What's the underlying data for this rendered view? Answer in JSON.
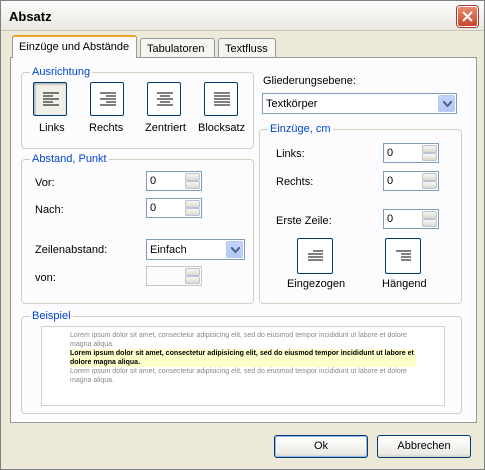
{
  "window": {
    "title": "Absatz"
  },
  "tabs": [
    {
      "label": "Einzüge und Abstände",
      "active": true
    },
    {
      "label": "Tabulatoren",
      "active": false
    },
    {
      "label": "Textfluss",
      "active": false
    }
  ],
  "alignment": {
    "group_label": "Ausrichtung",
    "buttons": [
      {
        "label": "Links",
        "icon": "align-left-icon",
        "pressed": true
      },
      {
        "label": "Rechts",
        "icon": "align-right-icon",
        "pressed": false
      },
      {
        "label": "Zentriert",
        "icon": "align-center-icon",
        "pressed": false
      },
      {
        "label": "Blocksatz",
        "icon": "align-justify-icon",
        "pressed": false
      }
    ]
  },
  "outline": {
    "label": "Gliederungsebene:",
    "value": "Textkörper"
  },
  "spacing": {
    "group_label": "Abstand, Punkt",
    "before_label": "Vor:",
    "before_value": "0",
    "after_label": "Nach:",
    "after_value": "0",
    "line_label": "Zeilenabstand:",
    "line_value": "Einfach",
    "of_label": "von:",
    "of_value": ""
  },
  "indent": {
    "group_label": "Einzüge, cm",
    "left_label": "Links:",
    "left_value": "0",
    "right_label": "Rechts:",
    "right_value": "0",
    "first_label": "Erste Zeile:",
    "first_value": "0",
    "indented_label": "Eingezogen",
    "hanging_label": "Hängend"
  },
  "example": {
    "group_label": "Beispiel",
    "line1": "Lorem ipsum dolor sit amet, consectetur adipisicing elit, sed do eiusmod tempor incididunt ut labore et dolore magna aliqua.",
    "line2": "Lorem ipsum dolor sit amet, consectetur adipisicing elit, sed do eiusmod tempor incididunt ut labore et dolore magna aliqua.",
    "line3": "Lorem ipsum dolor sit amet, consectetur adipisicing elit, sed do eiusmod tempor incididunt ut labore et dolore magna aliqua."
  },
  "footer": {
    "ok_label": "Ok",
    "cancel_label": "Abbrechen"
  },
  "colors": {
    "group_label": "#0046d5",
    "tab_highlight": "#e6a627",
    "close_button": "#c7442a"
  }
}
